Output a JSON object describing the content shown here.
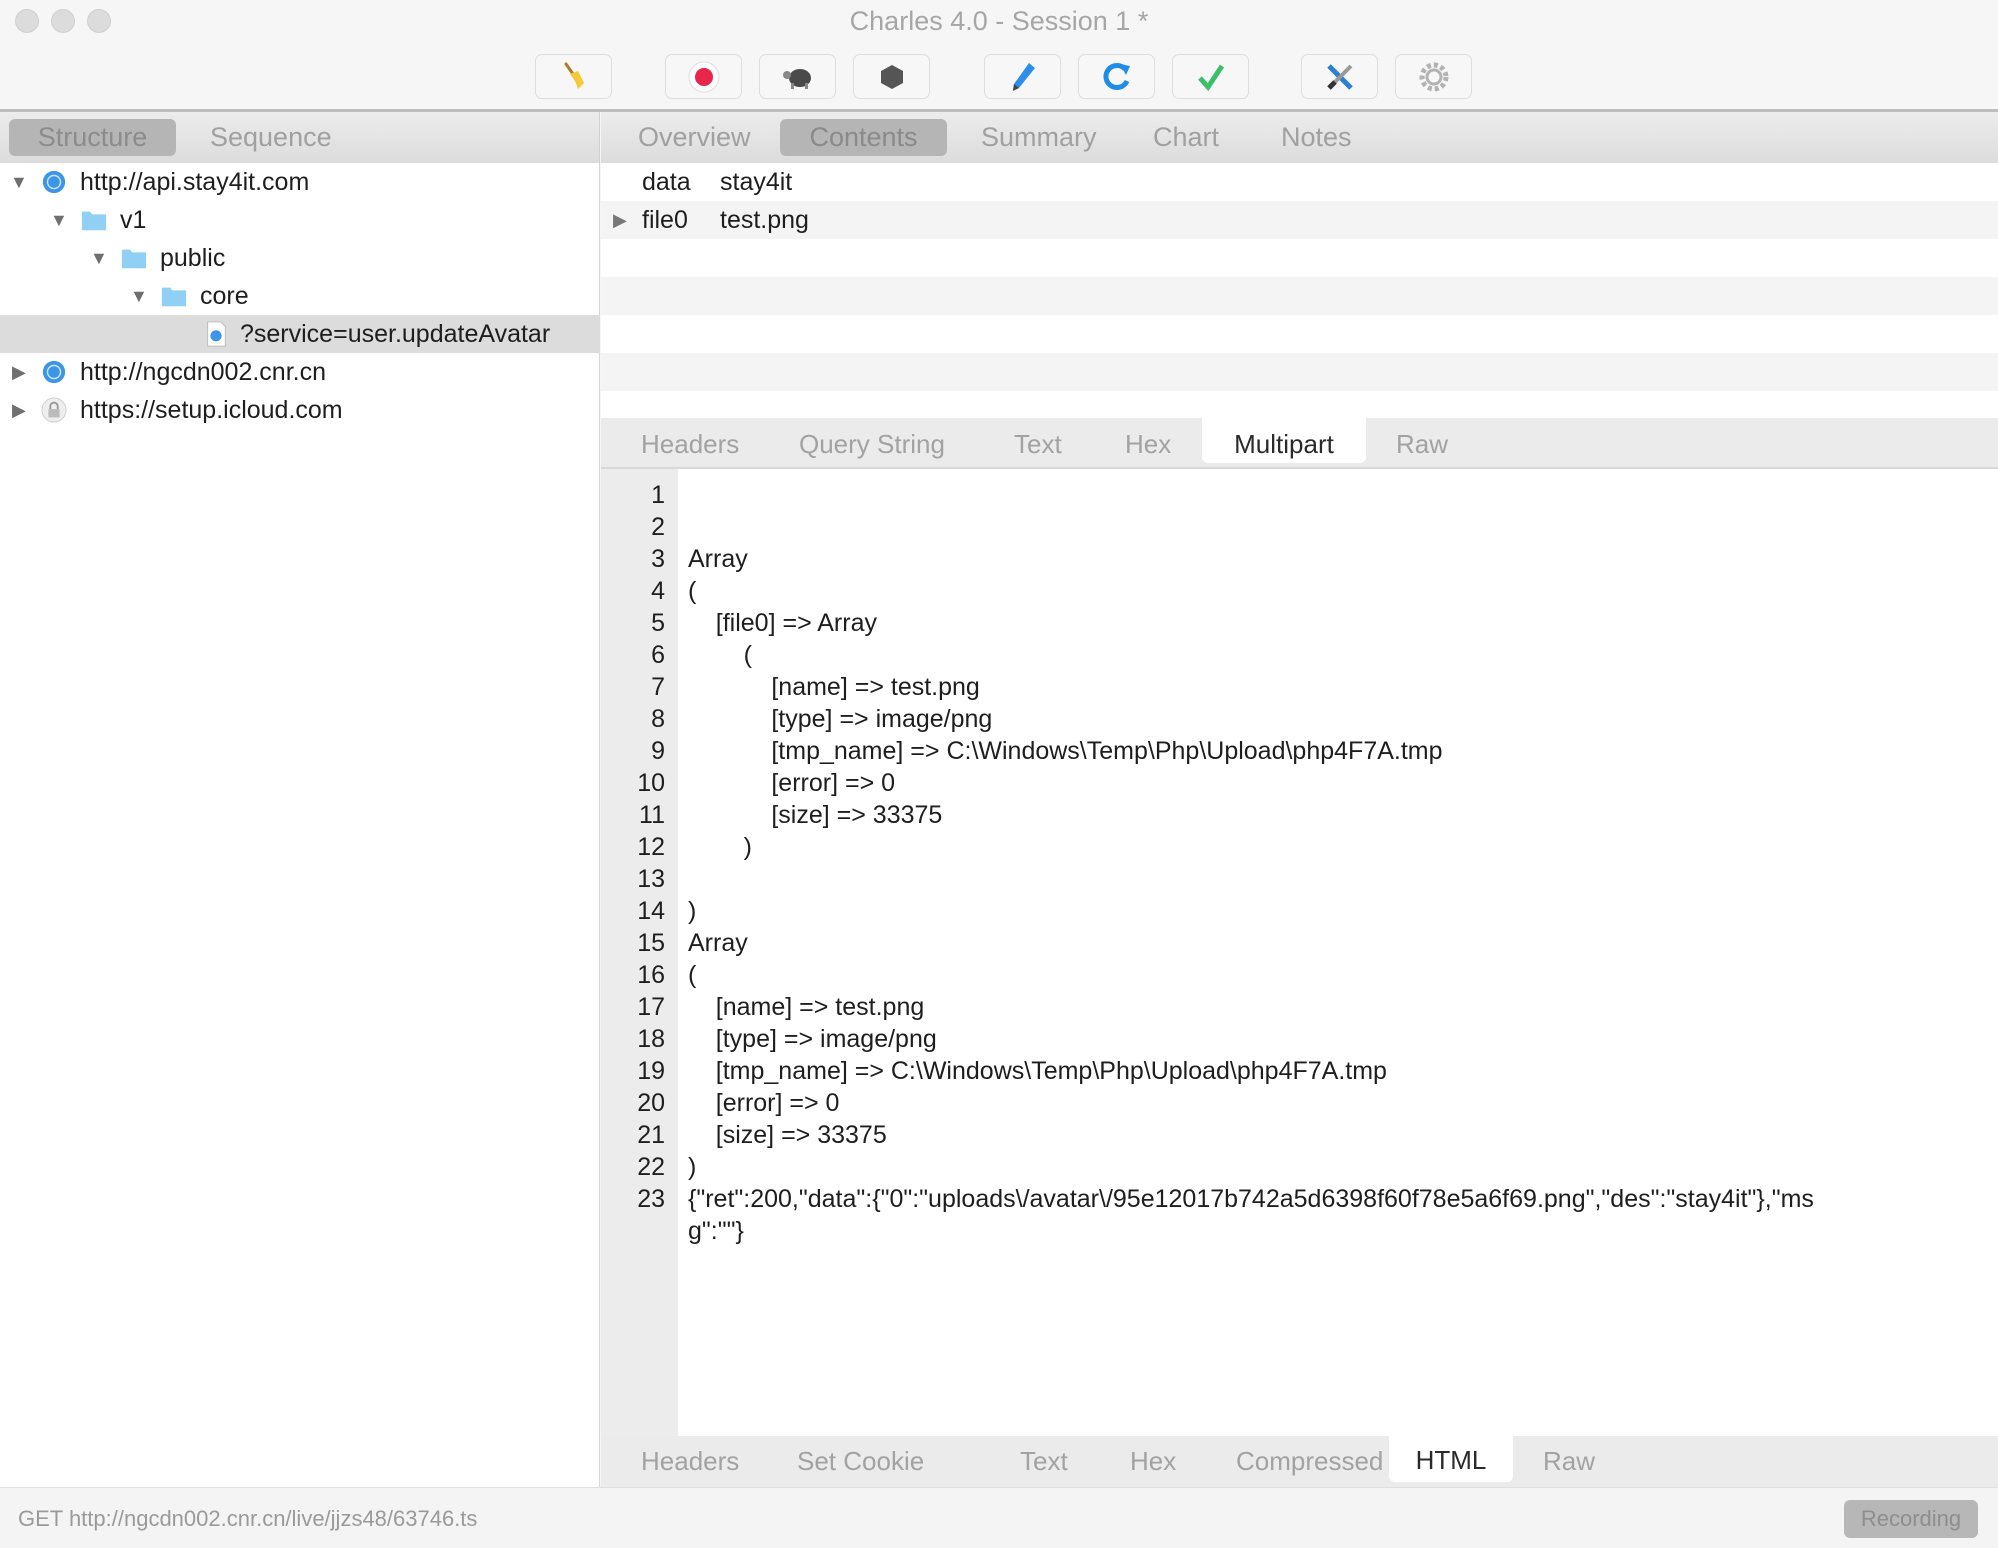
{
  "window": {
    "title": "Charles 4.0 - Session 1 *"
  },
  "toolbar": {
    "buttons": [
      {
        "name": "broom-icon",
        "label": "Clear"
      },
      {
        "name": "record-icon",
        "label": "Record"
      },
      {
        "name": "turtle-icon",
        "label": "Throttle"
      },
      {
        "name": "breakpoint-hexagon-icon",
        "label": "Breakpoints"
      },
      {
        "name": "pen-icon",
        "label": "Compose"
      },
      {
        "name": "refresh-icon",
        "label": "Repeat"
      },
      {
        "name": "checkmark-icon",
        "label": "Validate"
      },
      {
        "name": "tools-icon",
        "label": "Tools"
      },
      {
        "name": "gear-icon",
        "label": "Settings"
      }
    ]
  },
  "left_tabs": [
    {
      "label": "Structure",
      "selected": true
    },
    {
      "label": "Sequence",
      "selected": false
    }
  ],
  "right_tabs": [
    {
      "label": "Overview",
      "selected": false
    },
    {
      "label": "Contents",
      "selected": true
    },
    {
      "label": "Summary",
      "selected": false
    },
    {
      "label": "Chart",
      "selected": false
    },
    {
      "label": "Notes",
      "selected": false
    }
  ],
  "tree": [
    {
      "label": "http://api.stay4it.com",
      "icon": "globe",
      "expanded": true,
      "depth": 0
    },
    {
      "label": "v1",
      "icon": "folder",
      "expanded": true,
      "depth": 1
    },
    {
      "label": "public",
      "icon": "folder",
      "expanded": true,
      "depth": 2
    },
    {
      "label": "core",
      "icon": "folder",
      "expanded": true,
      "depth": 3
    },
    {
      "label": "?service=user.updateAvatar",
      "icon": "file",
      "selected": true,
      "depth": 4
    },
    {
      "label": "http://ngcdn002.cnr.cn",
      "icon": "globe",
      "expanded": false,
      "depth": 0
    },
    {
      "label": "https://setup.icloud.com",
      "icon": "lock",
      "expanded": false,
      "depth": 0
    }
  ],
  "form_table": [
    {
      "key": "data",
      "value": "stay4it",
      "expandable": false
    },
    {
      "key": "file0",
      "value": "test.png",
      "expandable": true
    }
  ],
  "request_tabs": [
    {
      "label": "Headers",
      "selected": false
    },
    {
      "label": "Query String",
      "selected": false
    },
    {
      "label": "Text",
      "selected": false
    },
    {
      "label": "Hex",
      "selected": false
    },
    {
      "label": "Multipart",
      "selected": true
    },
    {
      "label": "Raw",
      "selected": false
    }
  ],
  "code_lines": [
    "",
    "",
    "Array",
    "(",
    "    [file0] => Array",
    "        (",
    "            [name] => test.png",
    "            [type] => image/png",
    "            [tmp_name] => C:\\Windows\\Temp\\Php\\Upload\\php4F7A.tmp",
    "            [error] => 0",
    "            [size] => 33375",
    "        )",
    "",
    ")",
    "Array",
    "(",
    "    [name] => test.png",
    "    [type] => image/png",
    "    [tmp_name] => C:\\Windows\\Temp\\Php\\Upload\\php4F7A.tmp",
    "    [error] => 0",
    "    [size] => 33375",
    ")",
    "{\"ret\":200,\"data\":{\"0\":\"uploads\\/avatar\\/95e12017b742a5d6398f60f78e5a6f69.png\",\"des\":\"stay4it\"},\"msg\":\"\"}"
  ],
  "code_line23_wrap": [
    "{\"ret\":200,\"data\":{\"0\":\"uploads\\/avatar\\/95e12017b742a5d6398f60f78e5a6f69.png\",\"des\":\"stay4it\"},\"ms",
    "g\":\"\"}"
  ],
  "response_tabs": [
    {
      "label": "Headers",
      "selected": false
    },
    {
      "label": "Set Cookie",
      "selected": false
    },
    {
      "label": "Text",
      "selected": false
    },
    {
      "label": "Hex",
      "selected": false
    },
    {
      "label": "Compressed",
      "selected": false
    },
    {
      "label": "HTML",
      "selected": true
    },
    {
      "label": "Raw",
      "selected": false
    }
  ],
  "status": {
    "text": "GET http://ngcdn002.cnr.cn/live/jjzs48/63746.ts",
    "recording_label": "Recording"
  }
}
